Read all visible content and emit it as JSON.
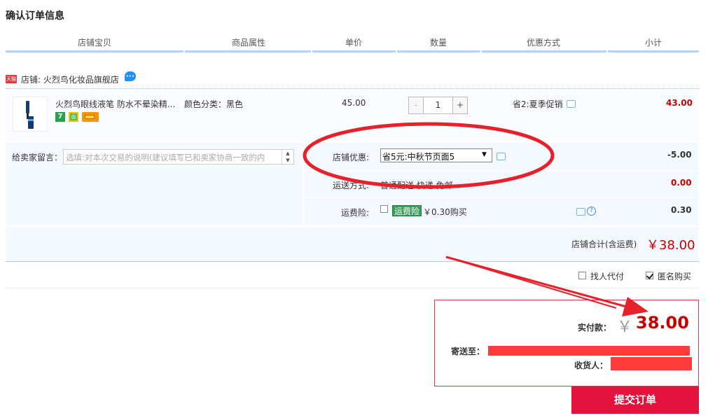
{
  "page_title": "确认订单信息",
  "columns": [
    "店铺宝贝",
    "商品属性",
    "单价",
    "数量",
    "优惠方式",
    "小计"
  ],
  "shop": {
    "badge": "天猫",
    "label": "店铺: 火烈鸟化妆品旗舰店"
  },
  "item": {
    "title": "火烈鸟眼线液笔 防水不晕染精...",
    "badge_1": "7",
    "attributes": "颜色分类：黑色",
    "price": "45.00",
    "qty_minus": "-",
    "quantity": "1",
    "qty_plus": "+",
    "promotion": "省2:夏季促销",
    "subtotal": "43.00"
  },
  "memo": {
    "label": "给卖家留言：",
    "placeholder": "选填:对本次交易的说明(建议填写已和卖家协商一致的内"
  },
  "shop_coupon": {
    "label": "店铺优惠:",
    "selected": "省5元:中秋节页面5",
    "amount": "-5.00"
  },
  "shipping": {
    "label": "运送方式:",
    "value": "普通配送 快递 免邮",
    "amount": "0.00"
  },
  "insurance": {
    "label": "运费险:",
    "badge": "运费险",
    "text": "￥0.30购买",
    "amount": "0.30"
  },
  "shop_total": {
    "label": "店铺合计(含运费)",
    "value": "￥38.00"
  },
  "options": {
    "proxy_label": "找人代付",
    "proxy_checked": false,
    "anonymous_label": "匿名购买",
    "anonymous_checked": true
  },
  "summary": {
    "pay_label": "实付款：",
    "currency": "￥",
    "pay_amount": "38.00",
    "ship_to_label": "寄送至：",
    "receiver_label": "收货人："
  },
  "submit_label": "提交订单",
  "colors": {
    "accent_red": "#e4123c",
    "price_red": "#c40000",
    "header_line": "#b2d1ff",
    "annotation_red": "#e8202a"
  }
}
